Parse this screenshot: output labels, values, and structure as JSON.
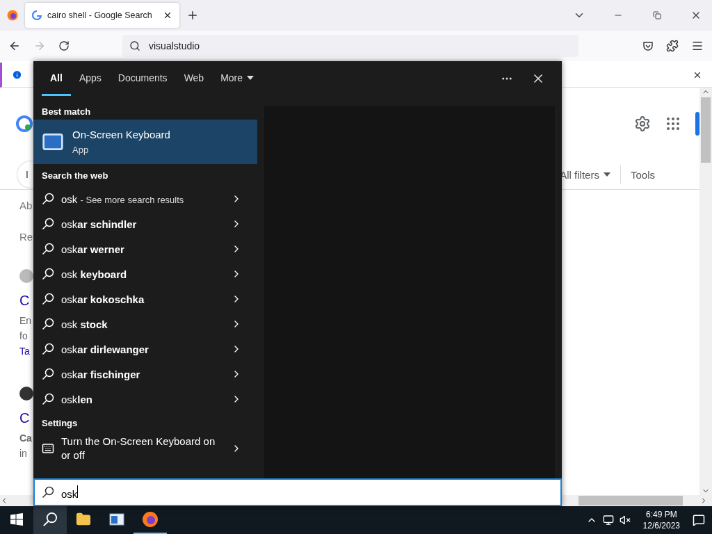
{
  "browser": {
    "tab": {
      "title": "cairo shell - Google Search"
    },
    "address": "visualstudio"
  },
  "page": {
    "chip": "I",
    "filters": "All filters",
    "tools": "Tools",
    "about": "Ab",
    "related": "Re",
    "results": [
      {
        "kind": "circle",
        "title": "C",
        "lines": [
          "En",
          "fo"
        ],
        "link": "Ta"
      },
      {
        "kind": "cat",
        "title": "C",
        "lines": [
          "**Ca**",
          "in"
        ]
      }
    ]
  },
  "search_panel": {
    "tabs": [
      {
        "label": "All",
        "selected": true
      },
      {
        "label": "Apps",
        "selected": false
      },
      {
        "label": "Documents",
        "selected": false
      },
      {
        "label": "Web",
        "selected": false
      },
      {
        "label": "More",
        "selected": false
      }
    ],
    "best_match_heading": "Best match",
    "best_match": {
      "title": "On-Screen Keyboard",
      "subtitle": "App"
    },
    "web_heading": "Search the web",
    "web_results": [
      {
        "kind": "more",
        "query": "osk",
        "note": "- See more search results"
      },
      {
        "kind": "suggestion",
        "text": "osk**ar schindler**"
      },
      {
        "kind": "suggestion",
        "text": "osk**ar werner**"
      },
      {
        "kind": "suggestion",
        "text": "osk **keyboard**"
      },
      {
        "kind": "suggestion",
        "text": "osk**ar kokoschka**"
      },
      {
        "kind": "suggestion",
        "text": "osk **stock**"
      },
      {
        "kind": "suggestion",
        "text": "osk**ar dirlewanger**"
      },
      {
        "kind": "suggestion",
        "text": "osk**ar fischinger**"
      },
      {
        "kind": "suggestion",
        "text": "osk**len**"
      }
    ],
    "settings_heading": "Settings",
    "settings_item": "Turn the On-Screen Keyboard on or off",
    "query": "osk"
  },
  "taskbar": {
    "apps": [
      {
        "kind": "search",
        "selected": true
      },
      {
        "kind": "folder",
        "selected": false
      },
      {
        "kind": "window",
        "selected": false
      },
      {
        "kind": "firefox",
        "selected": true
      }
    ],
    "time": "6:49 PM",
    "date": "12/6/2023"
  }
}
